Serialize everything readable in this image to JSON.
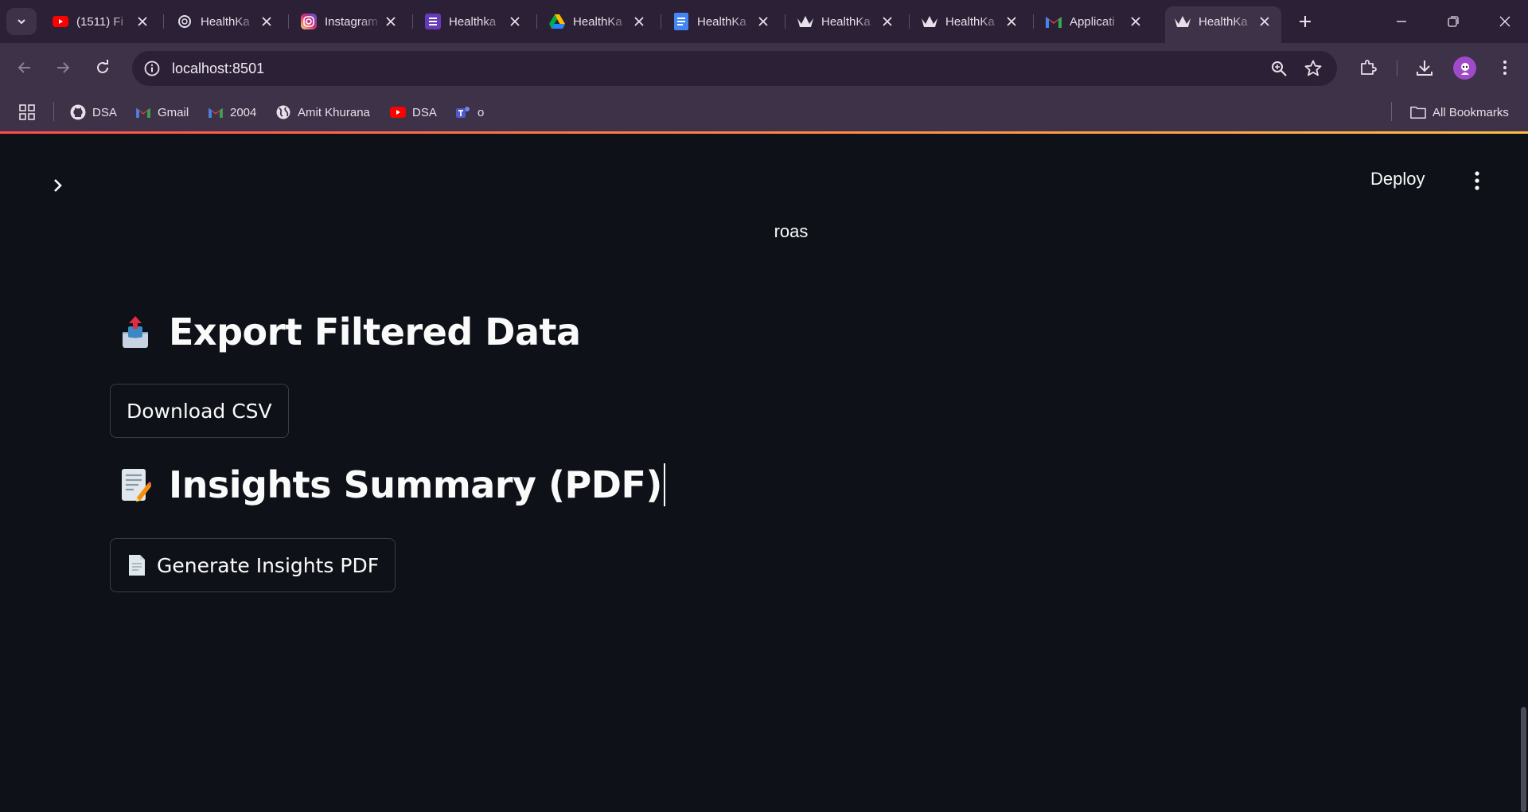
{
  "browser": {
    "tabs": [
      {
        "title": "(1511) Fi",
        "icon": "youtube-icon"
      },
      {
        "title": "HealthKa",
        "icon": "chatgpt-icon"
      },
      {
        "title": "Instagram",
        "icon": "instagram-icon"
      },
      {
        "title": "Healthka",
        "icon": "forms-icon"
      },
      {
        "title": "HealthKa",
        "icon": "drive-icon"
      },
      {
        "title": "HealthKa",
        "icon": "docs-icon"
      },
      {
        "title": "HealthKa",
        "icon": "streamlit-icon"
      },
      {
        "title": "HealthKa",
        "icon": "streamlit-icon"
      },
      {
        "title": "Applicati",
        "icon": "gmail-icon"
      },
      {
        "title": "HealthKa",
        "icon": "streamlit-icon",
        "active": true
      }
    ],
    "url": "localhost:8501",
    "bookmarks": [
      {
        "label": "DSA",
        "icon": "github-icon"
      },
      {
        "label": "Gmail",
        "icon": "gmail-icon"
      },
      {
        "label": "2004",
        "icon": "gmail-icon"
      },
      {
        "label": "Amit Khurana",
        "icon": "globe-icon"
      },
      {
        "label": "DSA",
        "icon": "youtube-icon"
      },
      {
        "label": "o",
        "icon": "teams-icon"
      }
    ],
    "all_bookmarks": "All Bookmarks"
  },
  "app": {
    "deploy_label": "Deploy",
    "metric_label": "roas",
    "export_heading": "Export Filtered Data",
    "download_button": "Download CSV",
    "insights_heading": "Insights Summary (PDF)",
    "generate_button": "Generate Insights PDF"
  },
  "colors": {
    "background": "#0e1117",
    "browser_frame": "#3d3247",
    "tab_strip": "#2b2035",
    "accent_gradient_start": "#ff4b4b",
    "accent_gradient_end": "#ffbd45"
  }
}
